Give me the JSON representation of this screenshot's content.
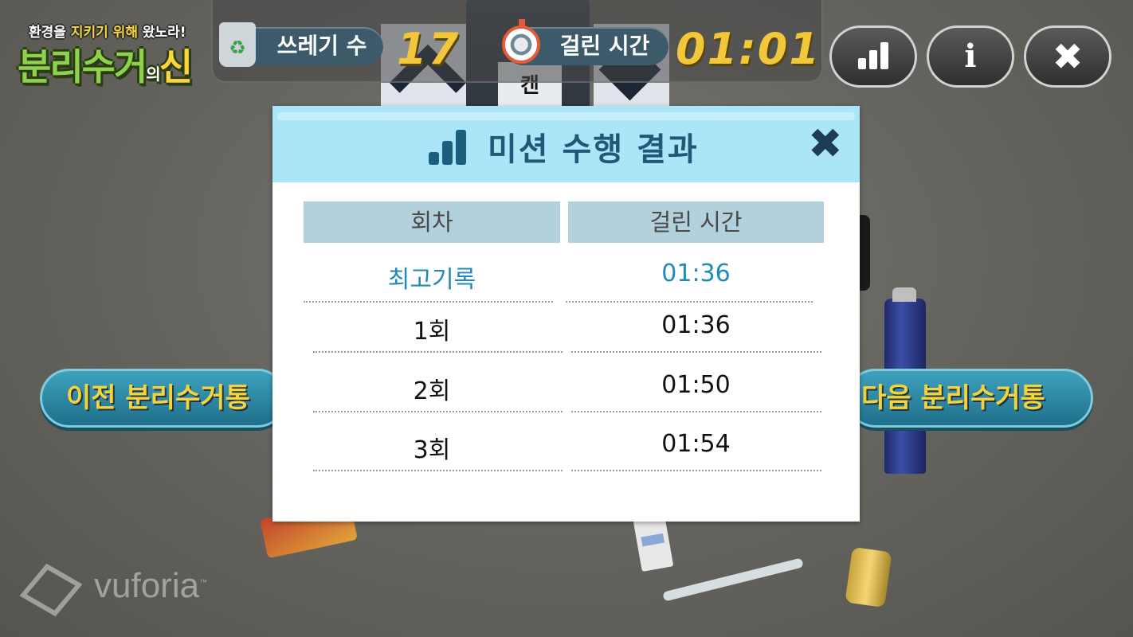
{
  "game": {
    "logo_tagline_prefix": "환경을 ",
    "logo_tagline_highlight": "지키기 위해",
    "logo_tagline_suffix": " 왔노라!",
    "logo_title_main": "분리수거",
    "logo_title_small": "의",
    "logo_title_end": "신"
  },
  "hud": {
    "trash_label": "쓰레기 수",
    "trash_count": "17",
    "time_label": "걸린 시간",
    "elapsed_time": "01:01",
    "info_glyph": "i",
    "close_glyph": "✖"
  },
  "background": {
    "box_label": "캔",
    "vuforia_brand": "vuforia",
    "vuforia_tm": "™"
  },
  "navigation": {
    "prev_label": "이전 분리수거통",
    "next_label": "다음 분리수거통"
  },
  "modal": {
    "title": "미션 수행 결과",
    "close_glyph": "✖",
    "columns": [
      "회차",
      "걸린 시간"
    ],
    "best_record": {
      "label": "최고기록",
      "time": "01:36"
    },
    "rows": [
      {
        "round": "1회",
        "time": "01:36"
      },
      {
        "round": "2회",
        "time": "01:50"
      },
      {
        "round": "3회",
        "time": "01:54"
      }
    ]
  },
  "colors": {
    "modal_header": "#aae6f8",
    "best_record_text": "#1f8ab5",
    "hud_value": "#f2c73a",
    "nav_text": "#f4d43a"
  },
  "icons": [
    "recycle-bin-icon",
    "stopwatch-icon",
    "bar-chart-icon",
    "info-icon",
    "close-icon"
  ]
}
